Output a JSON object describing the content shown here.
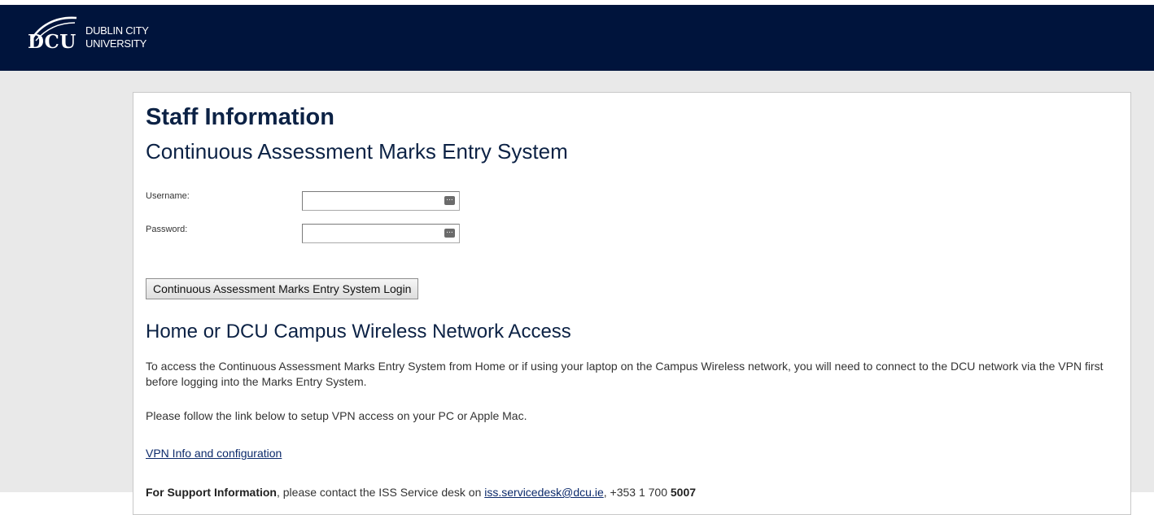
{
  "header": {
    "logo_mark": "DCU",
    "logo_line1": "DUBLIN CITY",
    "logo_line2": "UNIVERSITY",
    "background": "#00143c"
  },
  "main": {
    "title": "Staff Information",
    "subtitle": "Continuous Assessment Marks Entry System",
    "form": {
      "username_label": "Username:",
      "username_value": "",
      "password_label": "Password:",
      "password_value": "",
      "login_button": "Continuous Assessment Marks Entry System Login"
    },
    "network": {
      "heading": "Home or DCU Campus Wireless Network Access",
      "paragraph1": "To access the Continuous Assessment Marks Entry System from Home or if using your laptop on the Campus Wireless network, you will need to connect to the DCU network via the VPN first before logging into the Marks Entry System.",
      "paragraph2": "Please follow the link below to setup VPN access on your PC or Apple Mac.",
      "vpn_link": "VPN Info and configuration"
    },
    "support": {
      "label": "For Support Information",
      "text": ", please contact the ISS Service desk on",
      "email": "iss.servicedesk@dcu.ie",
      "phone_prefix": ", +353 1 700 ",
      "phone_bold": "5007"
    }
  },
  "colors": {
    "brand_navy": "#00143c",
    "heading": "#0c2245",
    "page_background": "#e9e9e9",
    "link": "#0c2a6b"
  },
  "icons": {
    "password_manager": "key-dots-icon",
    "logo_swoosh": "dcu-swoosh-icon"
  }
}
